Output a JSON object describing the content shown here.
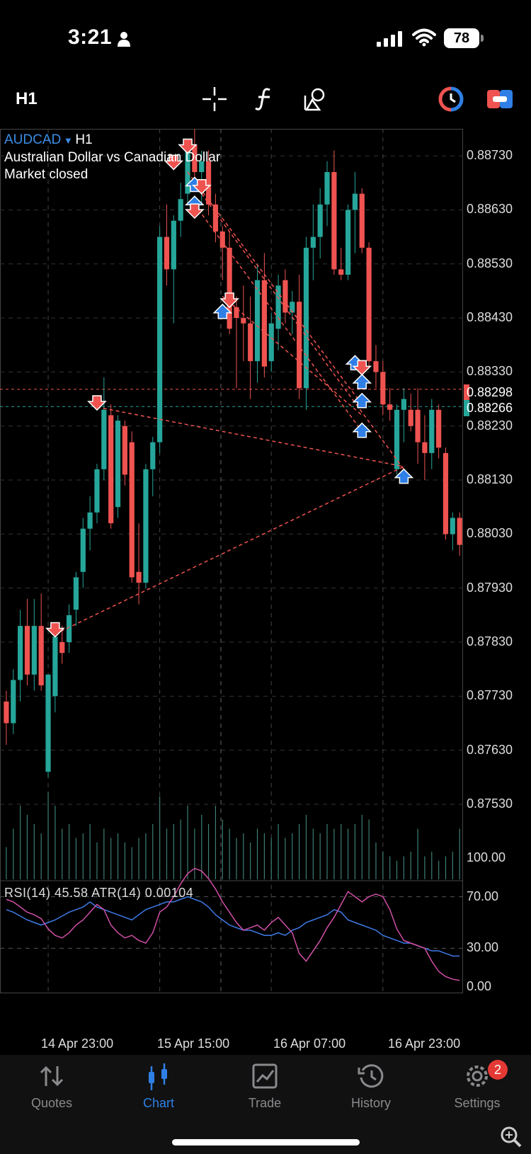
{
  "status_bar": {
    "time": "3:21",
    "battery": "78"
  },
  "toolbar": {
    "timeframe": "H1",
    "tools": [
      "crosshair-icon",
      "indicators-icon",
      "objects-icon",
      "trade-panel-icon",
      "one-click-icon"
    ]
  },
  "chart": {
    "symbol": "AUDCAD",
    "symbol_timeframe": "H1",
    "description": "Australian Dollar vs Canadian Dollar",
    "market_status": "Market closed",
    "bid_price": "0.88266",
    "ask_price": "0.88298",
    "bid_color": "#26a69a",
    "ask_color": "#ef5350",
    "bull_color": "#26a69a",
    "bear_color": "#ef5350",
    "price_axis": [
      "0.88730",
      "0.88630",
      "0.88530",
      "0.88430",
      "0.88330",
      "0.88230",
      "0.88130",
      "0.88030",
      "0.87930",
      "0.87830",
      "0.87730",
      "0.87630",
      "0.87530"
    ],
    "time_axis": [
      "14 Apr 23:00",
      "15 Apr 15:00",
      "16 Apr 07:00",
      "16 Apr 23:00"
    ]
  },
  "chart_data": {
    "type": "candlestick",
    "symbol": "AUDCAD",
    "timeframe": "H1",
    "ylim": [
      0.8745,
      0.8878
    ],
    "candles": [
      {
        "o": 0.8772,
        "h": 0.8774,
        "l": 0.8764,
        "c": 0.8768
      },
      {
        "o": 0.8768,
        "h": 0.8778,
        "l": 0.8766,
        "c": 0.8776
      },
      {
        "o": 0.8776,
        "h": 0.8789,
        "l": 0.8772,
        "c": 0.8786
      },
      {
        "o": 0.8786,
        "h": 0.8791,
        "l": 0.8775,
        "c": 0.8777
      },
      {
        "o": 0.8777,
        "h": 0.8791,
        "l": 0.8774,
        "c": 0.8786
      },
      {
        "o": 0.8786,
        "h": 0.8792,
        "l": 0.8774,
        "c": 0.8775
      },
      {
        "o": 0.8759,
        "h": 0.8777,
        "l": 0.8758,
        "c": 0.8777
      },
      {
        "o": 0.8773,
        "h": 0.8785,
        "l": 0.877,
        "c": 0.8784
      },
      {
        "o": 0.8783,
        "h": 0.8786,
        "l": 0.8779,
        "c": 0.8781
      },
      {
        "o": 0.8783,
        "h": 0.879,
        "l": 0.8781,
        "c": 0.8788
      },
      {
        "o": 0.8789,
        "h": 0.8796,
        "l": 0.8786,
        "c": 0.8795
      },
      {
        "o": 0.8796,
        "h": 0.8806,
        "l": 0.8793,
        "c": 0.8804
      },
      {
        "o": 0.8804,
        "h": 0.881,
        "l": 0.88,
        "c": 0.8807
      },
      {
        "o": 0.8807,
        "h": 0.8816,
        "l": 0.8805,
        "c": 0.8815
      },
      {
        "o": 0.8815,
        "h": 0.8832,
        "l": 0.8813,
        "c": 0.8826
      },
      {
        "o": 0.8825,
        "h": 0.8827,
        "l": 0.8804,
        "c": 0.8805
      },
      {
        "o": 0.8808,
        "h": 0.8825,
        "l": 0.8806,
        "c": 0.8824
      },
      {
        "o": 0.8823,
        "h": 0.8824,
        "l": 0.8812,
        "c": 0.8814
      },
      {
        "o": 0.882,
        "h": 0.8822,
        "l": 0.8794,
        "c": 0.8795
      },
      {
        "o": 0.8796,
        "h": 0.8805,
        "l": 0.879,
        "c": 0.8794
      },
      {
        "o": 0.8794,
        "h": 0.8816,
        "l": 0.8793,
        "c": 0.8815
      },
      {
        "o": 0.8815,
        "h": 0.8821,
        "l": 0.881,
        "c": 0.882
      },
      {
        "o": 0.882,
        "h": 0.886,
        "l": 0.8818,
        "c": 0.8858
      },
      {
        "o": 0.8858,
        "h": 0.8864,
        "l": 0.8849,
        "c": 0.8852
      },
      {
        "o": 0.8852,
        "h": 0.8862,
        "l": 0.8842,
        "c": 0.8861
      },
      {
        "o": 0.8861,
        "h": 0.8868,
        "l": 0.8858,
        "c": 0.8865
      },
      {
        "o": 0.8866,
        "h": 0.8876,
        "l": 0.8864,
        "c": 0.8875
      },
      {
        "o": 0.8875,
        "h": 0.8879,
        "l": 0.8869,
        "c": 0.887
      },
      {
        "o": 0.887,
        "h": 0.8874,
        "l": 0.8864,
        "c": 0.8872
      },
      {
        "o": 0.8872,
        "h": 0.8874,
        "l": 0.8862,
        "c": 0.8864
      },
      {
        "o": 0.8864,
        "h": 0.8866,
        "l": 0.8857,
        "c": 0.8859
      },
      {
        "o": 0.8859,
        "h": 0.886,
        "l": 0.885,
        "c": 0.8856
      },
      {
        "o": 0.8856,
        "h": 0.8859,
        "l": 0.884,
        "c": 0.8841
      },
      {
        "o": 0.8845,
        "h": 0.8847,
        "l": 0.883,
        "c": 0.8843
      },
      {
        "o": 0.8843,
        "h": 0.8849,
        "l": 0.8835,
        "c": 0.8842
      },
      {
        "o": 0.8842,
        "h": 0.8847,
        "l": 0.8828,
        "c": 0.8835
      },
      {
        "o": 0.8835,
        "h": 0.8853,
        "l": 0.8831,
        "c": 0.885
      },
      {
        "o": 0.885,
        "h": 0.8855,
        "l": 0.8832,
        "c": 0.8834
      },
      {
        "o": 0.8835,
        "h": 0.8844,
        "l": 0.8833,
        "c": 0.8842
      },
      {
        "o": 0.8841,
        "h": 0.8851,
        "l": 0.8837,
        "c": 0.8849
      },
      {
        "o": 0.885,
        "h": 0.8852,
        "l": 0.8842,
        "c": 0.8844
      },
      {
        "o": 0.8844,
        "h": 0.8848,
        "l": 0.884,
        "c": 0.8846
      },
      {
        "o": 0.8846,
        "h": 0.8851,
        "l": 0.8828,
        "c": 0.883
      },
      {
        "o": 0.883,
        "h": 0.8858,
        "l": 0.8826,
        "c": 0.8856
      },
      {
        "o": 0.8856,
        "h": 0.8864,
        "l": 0.885,
        "c": 0.8858
      },
      {
        "o": 0.8858,
        "h": 0.8867,
        "l": 0.8854,
        "c": 0.8864
      },
      {
        "o": 0.8864,
        "h": 0.8872,
        "l": 0.886,
        "c": 0.887
      },
      {
        "o": 0.887,
        "h": 0.8874,
        "l": 0.8851,
        "c": 0.8852
      },
      {
        "o": 0.8852,
        "h": 0.8856,
        "l": 0.885,
        "c": 0.8851
      },
      {
        "o": 0.8851,
        "h": 0.8864,
        "l": 0.885,
        "c": 0.8863
      },
      {
        "o": 0.8863,
        "h": 0.887,
        "l": 0.8855,
        "c": 0.8866
      },
      {
        "o": 0.8866,
        "h": 0.8867,
        "l": 0.8855,
        "c": 0.8856
      },
      {
        "o": 0.8856,
        "h": 0.8857,
        "l": 0.8834,
        "c": 0.8835
      },
      {
        "o": 0.8835,
        "h": 0.8838,
        "l": 0.883,
        "c": 0.8833
      },
      {
        "o": 0.8833,
        "h": 0.8835,
        "l": 0.8825,
        "c": 0.8827
      },
      {
        "o": 0.8827,
        "h": 0.883,
        "l": 0.8824,
        "c": 0.8826
      },
      {
        "o": 0.8815,
        "h": 0.8827,
        "l": 0.8814,
        "c": 0.8826
      },
      {
        "o": 0.8826,
        "h": 0.883,
        "l": 0.882,
        "c": 0.8828
      },
      {
        "o": 0.8826,
        "h": 0.8829,
        "l": 0.8822,
        "c": 0.8823
      },
      {
        "o": 0.8826,
        "h": 0.883,
        "l": 0.8816,
        "c": 0.882
      },
      {
        "o": 0.882,
        "h": 0.8825,
        "l": 0.8813,
        "c": 0.8818
      },
      {
        "o": 0.8818,
        "h": 0.8828,
        "l": 0.8815,
        "c": 0.8826
      },
      {
        "o": 0.8826,
        "h": 0.8827,
        "l": 0.8817,
        "c": 0.8819
      },
      {
        "o": 0.8818,
        "h": 0.8819,
        "l": 0.8802,
        "c": 0.8803
      },
      {
        "o": 0.8803,
        "h": 0.8807,
        "l": 0.88,
        "c": 0.8806
      },
      {
        "o": 0.8806,
        "h": 0.8807,
        "l": 0.8799,
        "c": 0.8801
      }
    ],
    "volume": [
      0.35,
      0.55,
      0.8,
      0.7,
      0.6,
      0.5,
      0.95,
      0.8,
      0.55,
      0.6,
      0.45,
      0.5,
      0.6,
      0.4,
      0.55,
      0.45,
      0.5,
      0.4,
      0.35,
      0.45,
      0.5,
      0.6,
      0.9,
      0.55,
      0.6,
      0.65,
      0.8,
      0.55,
      0.7,
      0.6,
      0.8,
      0.65,
      0.55,
      0.45,
      0.5,
      0.4,
      0.55,
      0.5,
      0.45,
      0.6,
      0.45,
      0.5,
      0.6,
      0.7,
      0.55,
      0.5,
      0.6,
      0.55,
      0.6,
      0.55,
      0.6,
      0.7,
      0.65,
      0.4,
      0.3,
      0.25,
      0.2,
      0.25,
      0.3,
      0.55,
      0.25,
      0.3,
      0.2,
      0.25,
      0.3,
      0.55
    ],
    "trade_lines": [
      {
        "from": [
          7,
          0.87845
        ],
        "to": [
          57,
          0.88155
        ]
      },
      {
        "from": [
          13,
          0.88265
        ],
        "to": [
          57,
          0.88155
        ]
      },
      {
        "from": [
          26,
          0.887
        ],
        "to": [
          51,
          0.8827
        ]
      },
      {
        "from": [
          27,
          0.8864
        ],
        "to": [
          51,
          0.8822
        ]
      },
      {
        "from": [
          31,
          0.8847
        ],
        "to": [
          51,
          0.8825
        ]
      },
      {
        "from": [
          28,
          0.8866
        ],
        "to": [
          57,
          0.8815
        ]
      }
    ],
    "trade_markers": [
      {
        "i": 7,
        "y": 0.87845,
        "dir": "sell"
      },
      {
        "i": 13,
        "y": 0.88265,
        "dir": "sell"
      },
      {
        "i": 24,
        "y": 0.8871,
        "dir": "sell"
      },
      {
        "i": 26,
        "y": 0.8874,
        "dir": "sell"
      },
      {
        "i": 27,
        "y": 0.88685,
        "dir": "buy"
      },
      {
        "i": 28,
        "y": 0.88665,
        "dir": "sell"
      },
      {
        "i": 27,
        "y": 0.8865,
        "dir": "buy"
      },
      {
        "i": 27,
        "y": 0.8862,
        "dir": "sell"
      },
      {
        "i": 31,
        "y": 0.8845,
        "dir": "buy"
      },
      {
        "i": 32,
        "y": 0.88455,
        "dir": "sell"
      },
      {
        "i": 50,
        "y": 0.88355,
        "dir": "buy"
      },
      {
        "i": 51,
        "y": 0.8833,
        "dir": "sell"
      },
      {
        "i": 51,
        "y": 0.8832,
        "dir": "buy"
      },
      {
        "i": 51,
        "y": 0.88285,
        "dir": "buy"
      },
      {
        "i": 51,
        "y": 0.8823,
        "dir": "buy"
      },
      {
        "i": 57,
        "y": 0.88145,
        "dir": "buy"
      }
    ],
    "bid": 0.88266,
    "ask": 0.88298,
    "indicators": {
      "header": "RSI(14) 45.58 ATR(14) 0.00104",
      "rsi_color": "#d14fa7",
      "atr_color": "#3f7be6",
      "levels": [
        "100.00",
        "70.00",
        "30.00",
        "0.00"
      ],
      "rsi": [
        68,
        66,
        62,
        58,
        56,
        53,
        45,
        40,
        38,
        42,
        48,
        52,
        58,
        64,
        60,
        48,
        42,
        38,
        40,
        36,
        34,
        42,
        58,
        62,
        70,
        80,
        88,
        92,
        90,
        84,
        76,
        66,
        58,
        50,
        44,
        46,
        48,
        44,
        50,
        54,
        48,
        42,
        26,
        20,
        28,
        36,
        46,
        54,
        64,
        74,
        70,
        66,
        70,
        72,
        70,
        60,
        45,
        36,
        34,
        32,
        30,
        20,
        12,
        8,
        6,
        5
      ],
      "atr": [
        60,
        58,
        55,
        52,
        50,
        48,
        50,
        52,
        55,
        58,
        60,
        62,
        66,
        62,
        60,
        58,
        56,
        54,
        52,
        56,
        60,
        62,
        64,
        66,
        66,
        68,
        70,
        68,
        66,
        62,
        56,
        52,
        48,
        46,
        44,
        44,
        42,
        40,
        40,
        42,
        40,
        44,
        46,
        50,
        52,
        54,
        56,
        60,
        58,
        52,
        50,
        48,
        46,
        44,
        40,
        38,
        36,
        34,
        34,
        32,
        30,
        28,
        28,
        26,
        24,
        24
      ]
    }
  },
  "tabs": [
    {
      "label": "Quotes",
      "icon": "quotes-icon"
    },
    {
      "label": "Chart",
      "icon": "chart-icon"
    },
    {
      "label": "Trade",
      "icon": "trade-icon"
    },
    {
      "label": "History",
      "icon": "history-icon"
    },
    {
      "label": "Settings",
      "icon": "settings-icon"
    }
  ],
  "settings_badge": "2"
}
